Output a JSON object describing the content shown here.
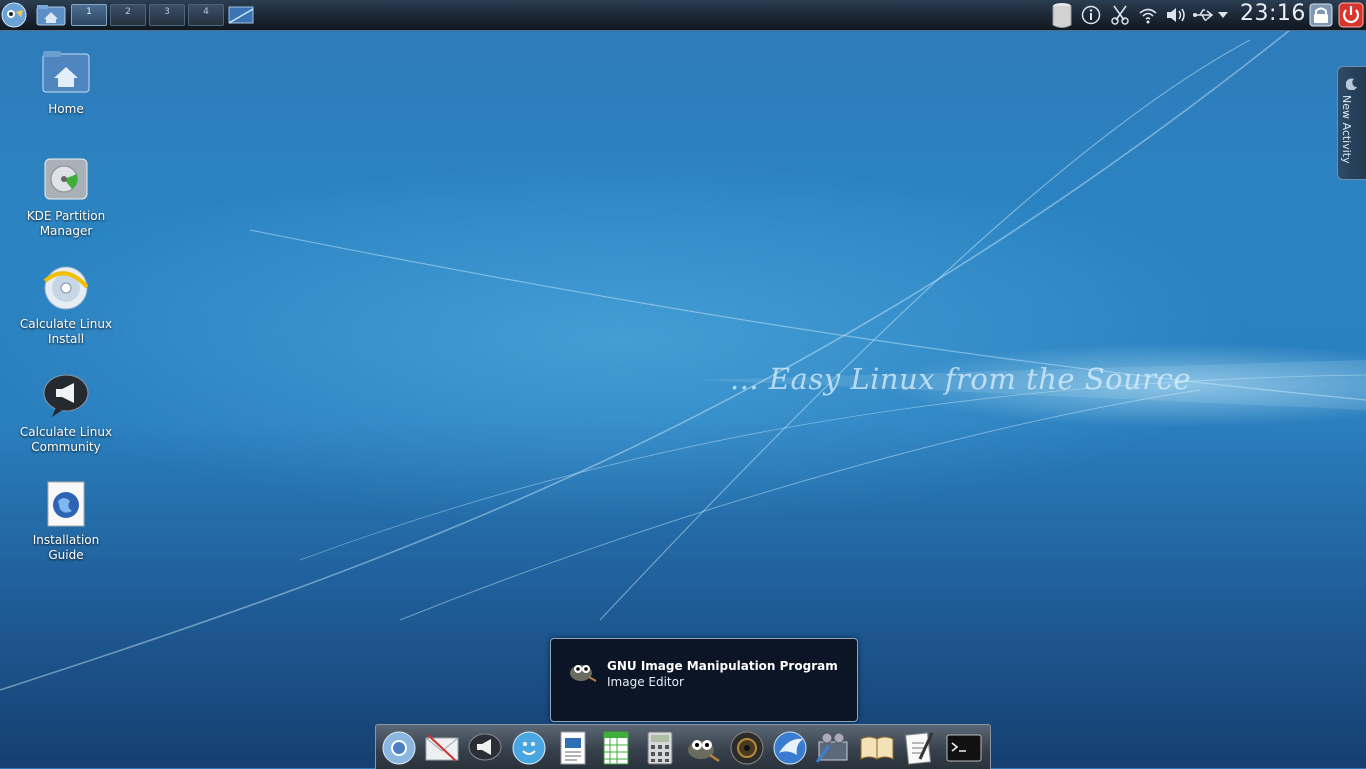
{
  "top_panel": {
    "pager_desktops": [
      "1",
      "2",
      "3",
      "4"
    ],
    "clock": "23:16",
    "icons": [
      "kde-menu-icon",
      "home-folder-icon",
      "show-desktop-icon",
      "trash-icon",
      "info-icon",
      "scissors-icon",
      "wifi-icon",
      "volume-icon",
      "usb-icon",
      "tray-expand-icon",
      "lock-screen-icon",
      "power-icon"
    ]
  },
  "desktop": {
    "icons": [
      {
        "label": "Home",
        "icon": "home-folder-icon"
      },
      {
        "label": "KDE Partition Manager",
        "icon": "partition-manager-icon"
      },
      {
        "label": "Calculate Linux Install",
        "icon": "install-disc-icon"
      },
      {
        "label": "Calculate Linux Community",
        "icon": "megaphone-bubble-icon"
      },
      {
        "label": "Installation Guide",
        "icon": "globe-document-icon"
      }
    ],
    "slogan": "... Easy Linux from the Source"
  },
  "activity_tab": {
    "label": "New Activity"
  },
  "tooltip": {
    "title": "GNU Image Manipulation Program",
    "subtitle": "Image Editor"
  },
  "dock": {
    "apps": [
      "chromium-icon",
      "mail-icon",
      "megaphone-icon",
      "chat-icon",
      "writer-icon",
      "calc-spreadsheet-icon",
      "calculator-icon",
      "gimp-icon",
      "camera-icon",
      "thunderbird-icon",
      "video-editor-icon",
      "dictionary-icon",
      "text-editor-icon",
      "terminal-icon"
    ]
  },
  "colors": {
    "panel": "#1b2735",
    "accent": "#2a7fbe",
    "tooltip_bg": "#0b1526",
    "power": "#d9342b"
  }
}
